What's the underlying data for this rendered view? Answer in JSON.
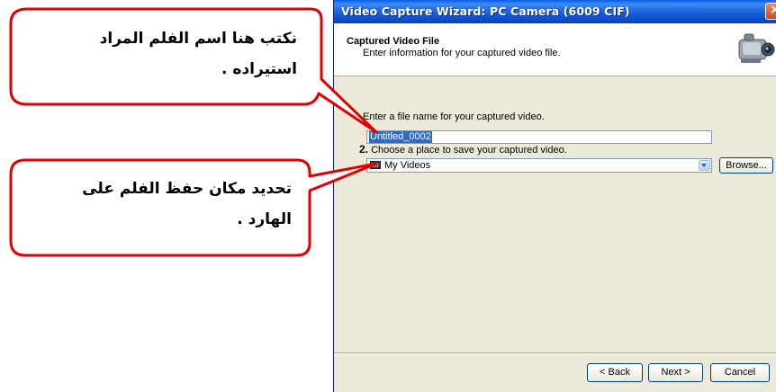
{
  "window": {
    "title": "Video Capture Wizard: PC Camera (6009 CIF)",
    "close_symbol": "×"
  },
  "header": {
    "title": "Captured Video File",
    "subtitle": "Enter information for your captured video file.",
    "icon": "camcorder-icon"
  },
  "step1": {
    "label": "Enter a file name for your captured video.",
    "value": "Untitled_0002"
  },
  "step2": {
    "number": "2.",
    "label": "Choose a place to save your captured video.",
    "selected": "My Videos",
    "browse_label": "Browse..."
  },
  "buttons": {
    "back": "< Back",
    "next": "Next >",
    "cancel": "Cancel"
  },
  "callouts": {
    "first": {
      "line1": "نكتب هنا اسم الفلم المراد",
      "line2": "استيراده ."
    },
    "second": {
      "line1": "تحديد مكان حفظ الفلم على",
      "line2": "الهارد ."
    },
    "color": "#e00000"
  }
}
